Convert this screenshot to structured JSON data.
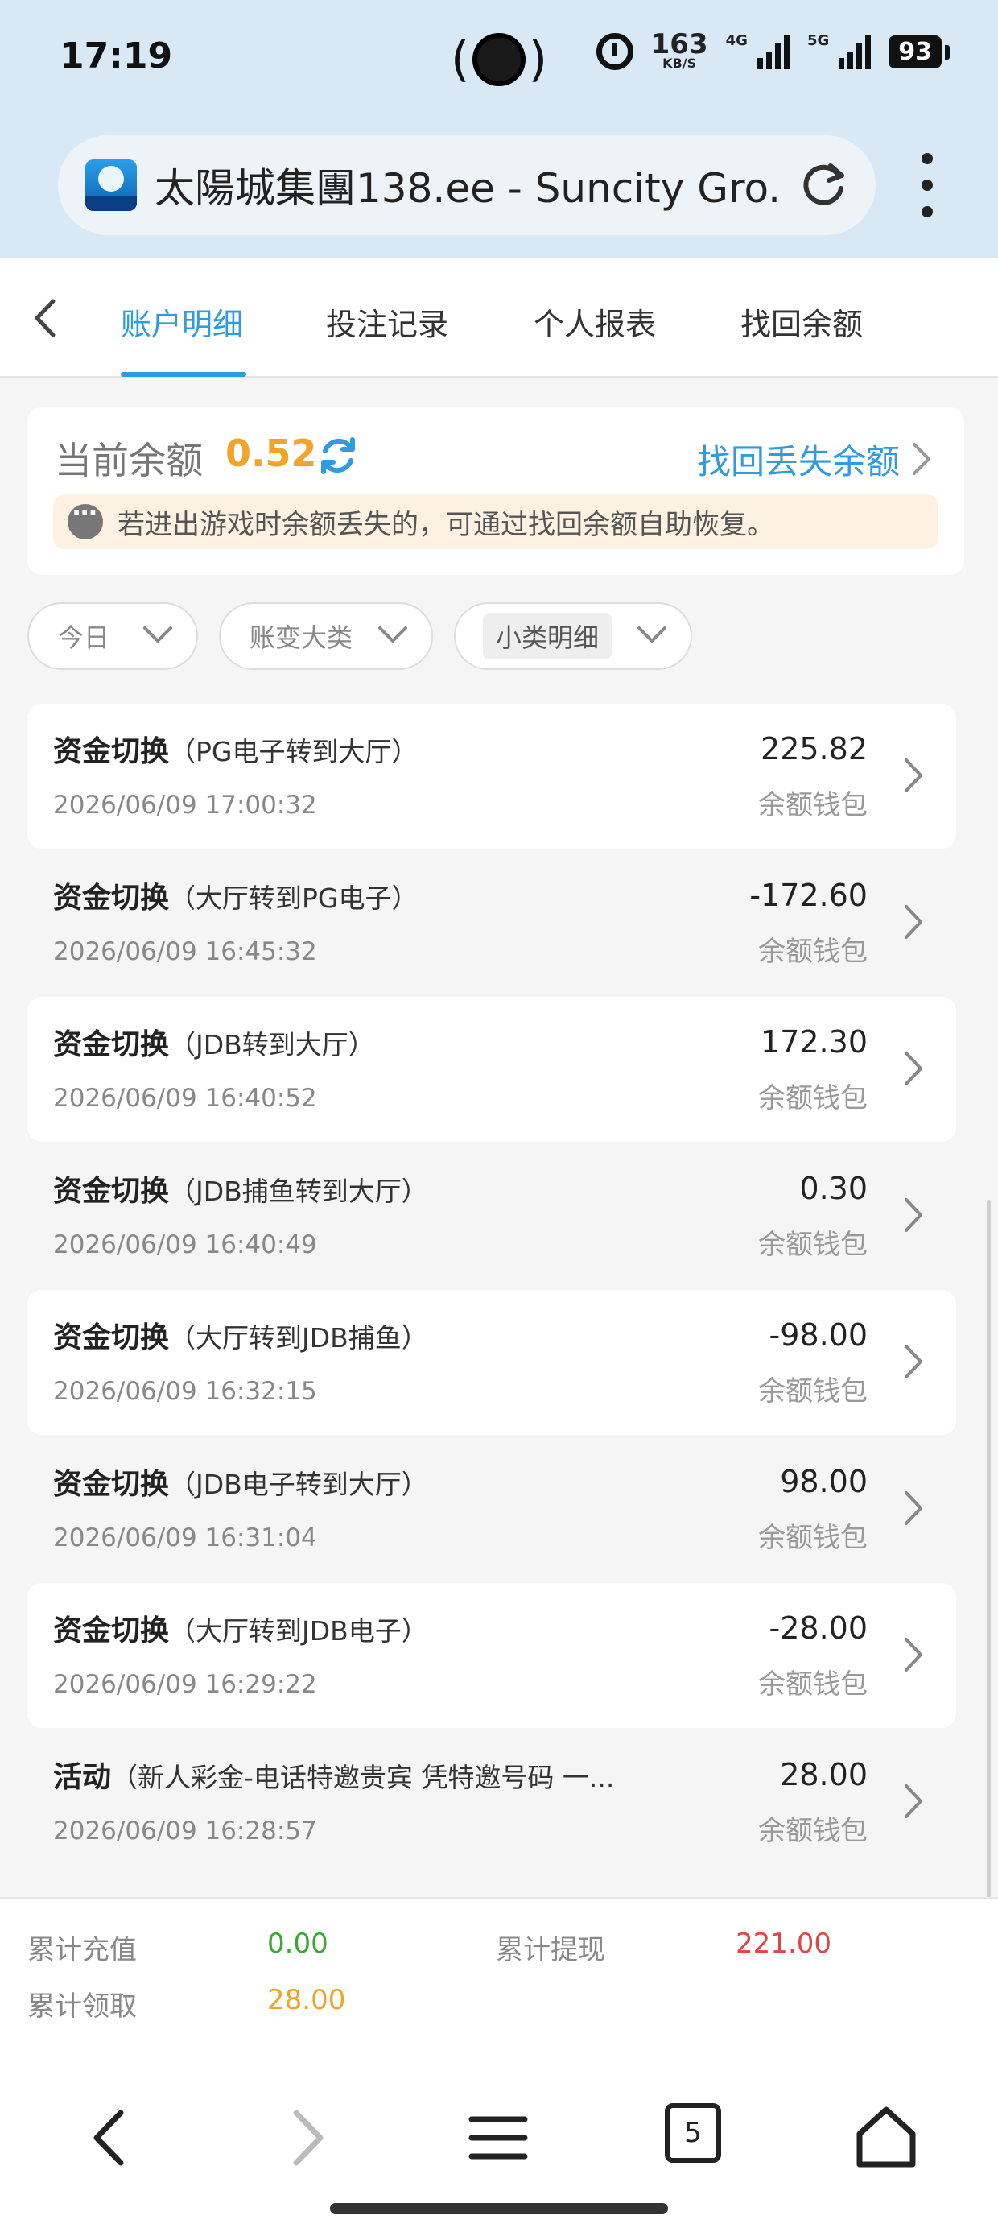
{
  "status_bar": {
    "time": "17:19",
    "speed_value": "163",
    "speed_unit": "KB/S",
    "net_4g": "4G",
    "net_5g": "5G",
    "battery": "93"
  },
  "browser": {
    "url_title": "太陽城集團138.ee - Suncity Gro...",
    "tab_count": "5"
  },
  "tabs": [
    "账户明细",
    "投注记录",
    "个人报表",
    "找回余额"
  ],
  "balance": {
    "label": "当前余额",
    "value": "0.52",
    "recover_link": "找回丢失余额",
    "notice": "若进出游戏时余额丢失的，可通过找回余额自助恢复。"
  },
  "filters": [
    "今日",
    "账变大类",
    "小类明细"
  ],
  "records": [
    {
      "type": "资金切换",
      "detail": "（PG电子转到大厅）",
      "time": "2026/06/09 17:00:32",
      "amount": "225.82",
      "wallet": "余额钱包"
    },
    {
      "type": "资金切换",
      "detail": "（大厅转到PG电子）",
      "time": "2026/06/09 16:45:32",
      "amount": "-172.60",
      "wallet": "余额钱包"
    },
    {
      "type": "资金切换",
      "detail": "（JDB转到大厅）",
      "time": "2026/06/09 16:40:52",
      "amount": "172.30",
      "wallet": "余额钱包"
    },
    {
      "type": "资金切换",
      "detail": "（JDB捕鱼转到大厅）",
      "time": "2026/06/09 16:40:49",
      "amount": "0.30",
      "wallet": "余额钱包"
    },
    {
      "type": "资金切换",
      "detail": "（大厅转到JDB捕鱼）",
      "time": "2026/06/09 16:32:15",
      "amount": "-98.00",
      "wallet": "余额钱包"
    },
    {
      "type": "资金切换",
      "detail": "（JDB电子转到大厅）",
      "time": "2026/06/09 16:31:04",
      "amount": "98.00",
      "wallet": "余额钱包"
    },
    {
      "type": "资金切换",
      "detail": "（大厅转到JDB电子）",
      "time": "2026/06/09 16:29:22",
      "amount": "-28.00",
      "wallet": "余额钱包"
    },
    {
      "type": "活动",
      "detail": "（新人彩金-电话特邀贵宾 凭特邀号码 一...",
      "time": "2026/06/09 16:28:57",
      "amount": "28.00",
      "wallet": "余额钱包"
    }
  ],
  "totals": {
    "recharge_label": "累计充值",
    "recharge_value": "0.00",
    "withdraw_label": "累计提现",
    "withdraw_value": "221.00",
    "claim_label": "累计领取",
    "claim_value": "28.00"
  },
  "colors": {
    "accent": "#2f9be0",
    "balance": "#f2a32a",
    "recharge": "#3aa832",
    "withdraw": "#e04646",
    "claim": "#f2a32a"
  }
}
